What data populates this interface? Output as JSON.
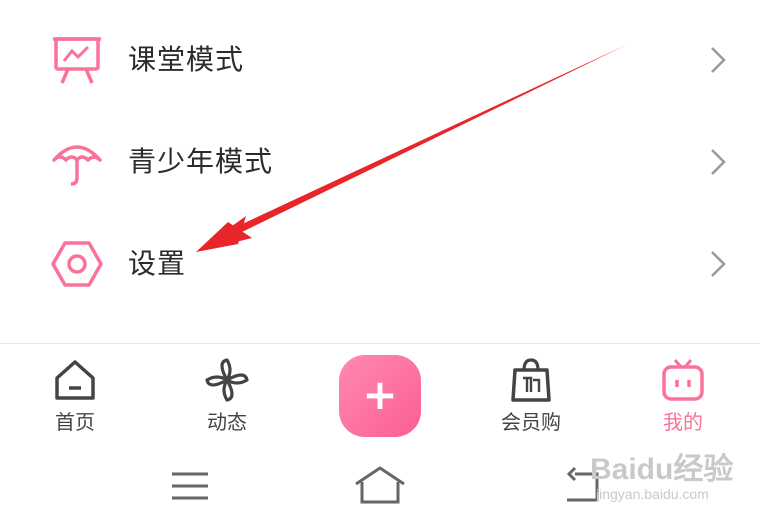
{
  "menu": {
    "items": [
      {
        "label": "课堂模式",
        "icon": "classroom-board-icon"
      },
      {
        "label": "青少年模式",
        "icon": "umbrella-icon"
      },
      {
        "label": "设置",
        "icon": "hexagon-settings-icon"
      }
    ]
  },
  "bottom_nav": {
    "tabs": [
      {
        "label": "首页",
        "icon": "home-icon",
        "active": false
      },
      {
        "label": "动态",
        "icon": "pinwheel-icon",
        "active": false
      },
      {
        "label": "会员购",
        "icon": "shopping-bag-icon",
        "active": false
      },
      {
        "label": "我的",
        "icon": "tv-mascot-icon",
        "active": true
      }
    ],
    "add_button": "+"
  },
  "system_nav": [
    "menu-icon",
    "home-outline-icon",
    "back-icon"
  ],
  "watermark": {
    "brand": "Baidu经验",
    "url": "jingyan.baidu.com"
  },
  "colors": {
    "accent": "#fb7299",
    "arrow": "#e8262a",
    "text": "#2b2b2b"
  }
}
